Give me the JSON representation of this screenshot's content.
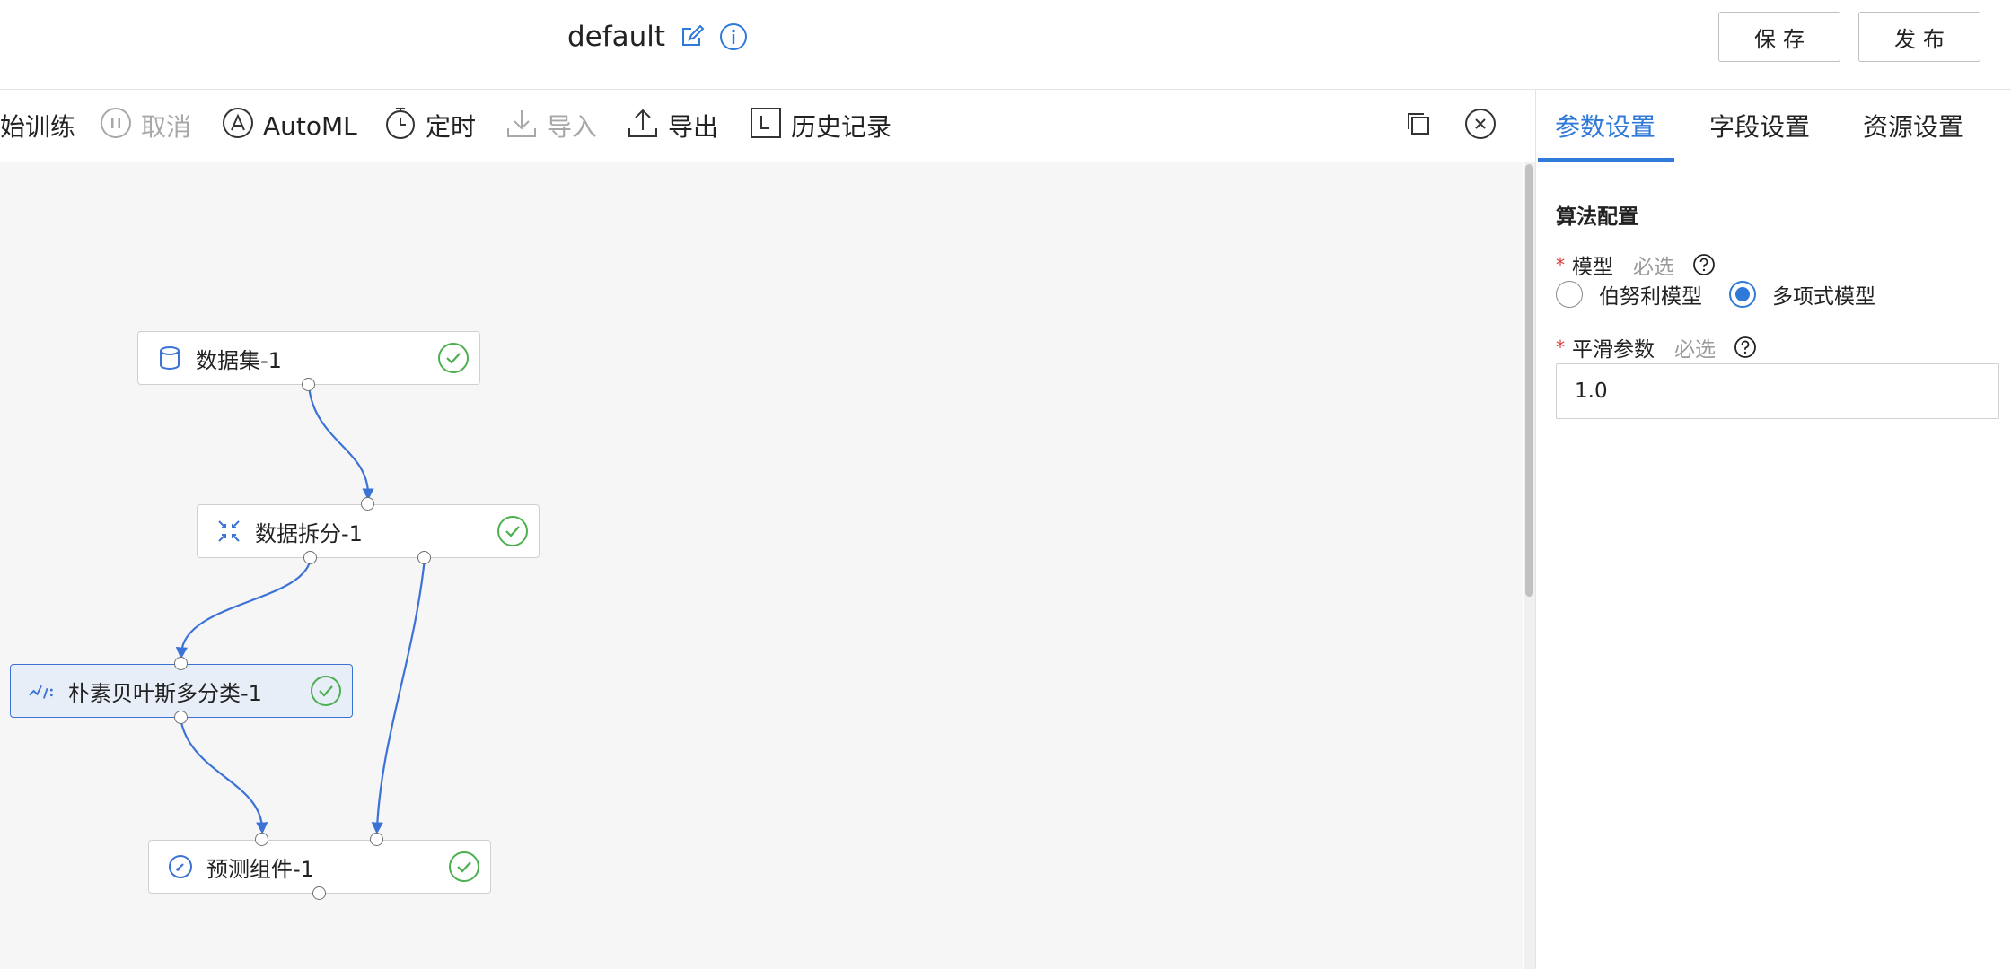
{
  "header": {
    "title": "default",
    "save_label": "保存",
    "publish_label": "发布"
  },
  "toolbar": {
    "start_training": "始训练",
    "cancel": "取消",
    "automl": "AutoML",
    "schedule": "定时",
    "import": "导入",
    "export": "导出",
    "history": "历史记录"
  },
  "canvas": {
    "nodes": [
      {
        "label": "数据集-1",
        "icon": "database-icon",
        "status": "success"
      },
      {
        "label": "数据拆分-1",
        "icon": "split-icon",
        "status": "success"
      },
      {
        "label": "朴素贝叶斯多分类-1",
        "icon": "algorithm-icon",
        "status": "success",
        "selected": true
      },
      {
        "label": "预测组件-1",
        "icon": "predict-icon",
        "status": "success"
      }
    ]
  },
  "panel": {
    "tabs": [
      {
        "label": "参数设置",
        "active": true
      },
      {
        "label": "字段设置",
        "active": false
      },
      {
        "label": "资源设置",
        "active": false
      }
    ],
    "section_title": "算法配置",
    "model": {
      "required_mark": "*",
      "label": "模型",
      "hint": "必选",
      "options": [
        "伯努利模型",
        "多项式模型"
      ],
      "selected": "多项式模型"
    },
    "smoothing": {
      "required_mark": "*",
      "label": "平滑参数",
      "hint": "必选",
      "value": "1.0"
    }
  },
  "colors": {
    "accent": "#2f79d9",
    "success": "#4caf50",
    "edge": "#3b72d6",
    "selected_node_bg": "#e8eef8"
  }
}
